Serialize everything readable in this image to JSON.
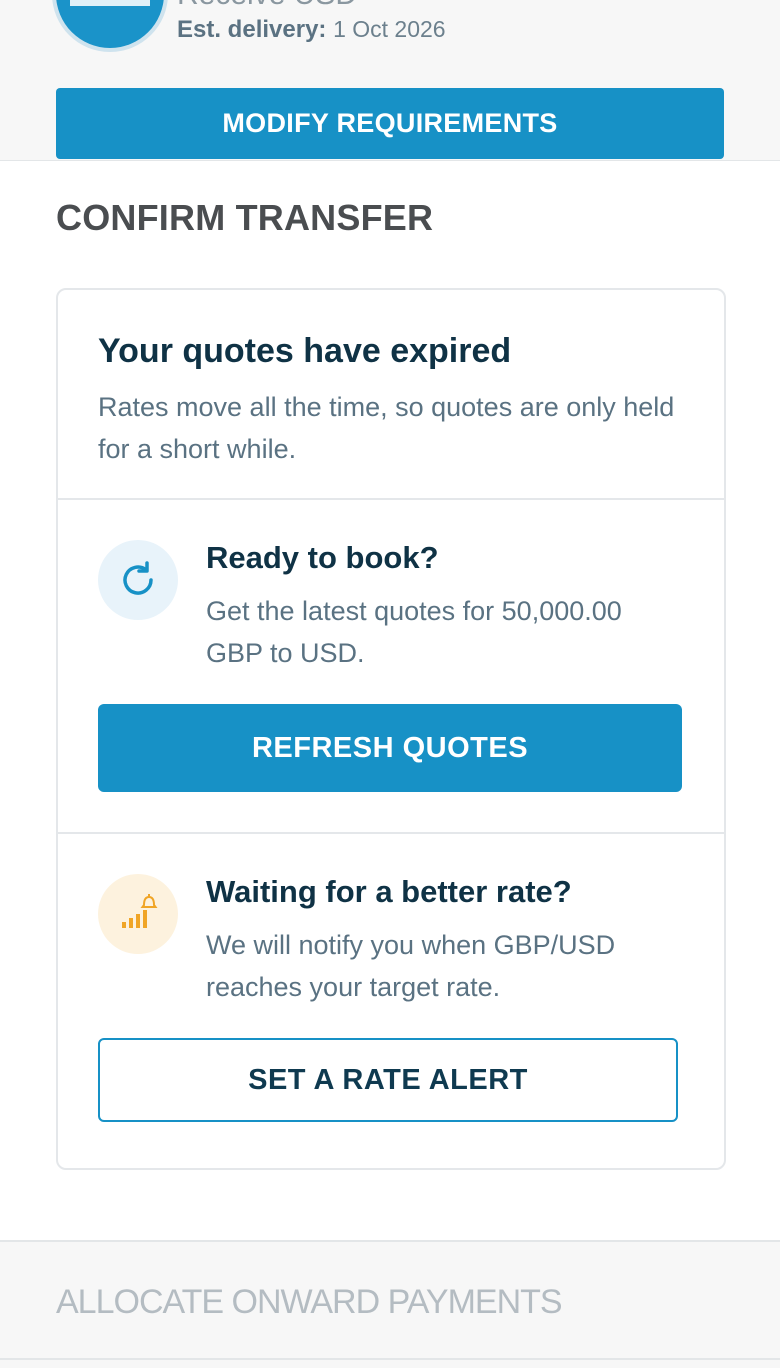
{
  "receive": {
    "title": "Receive USD",
    "delivery_label": "Est. delivery:",
    "delivery_value": "1 Oct 2026"
  },
  "actions": {
    "modify_label": "MODIFY REQUIREMENTS"
  },
  "section": {
    "title": "CONFIRM TRANSFER"
  },
  "expired": {
    "title": "Your quotes have expired",
    "description": "Rates move all the time, so quotes are only held for a short while."
  },
  "ready": {
    "title": "Ready to book?",
    "description": "Get the latest quotes for 50,000.00 GBP to USD.",
    "button_label": "REFRESH QUOTES",
    "icon": "refresh-icon"
  },
  "waiting": {
    "title": "Waiting for a better rate?",
    "description": "We will notify you when GBP/USD reaches your target rate.",
    "button_label": "SET A RATE ALERT",
    "icon": "rate-alert-icon"
  },
  "next_section": {
    "title": "ALLOCATE ONWARD PAYMENTS"
  },
  "colors": {
    "primary": "#1791c6",
    "heading": "#0f3245",
    "muted_text": "#5a7282",
    "alert_accent": "#f0a526"
  }
}
